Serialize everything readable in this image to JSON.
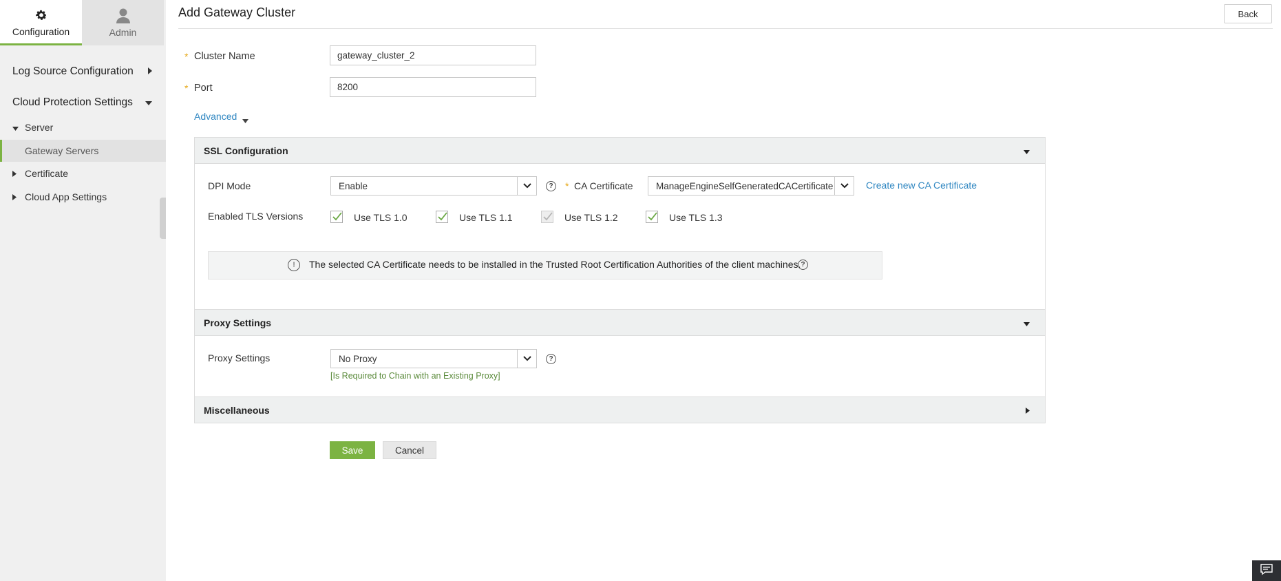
{
  "sidebar": {
    "tabs": [
      {
        "label": "Configuration",
        "icon": "gear-icon"
      },
      {
        "label": "Admin",
        "icon": "user-icon"
      }
    ],
    "sections": {
      "log_source": "Log Source Configuration",
      "cloud_protection": "Cloud Protection Settings"
    },
    "items": {
      "server": "Server",
      "gateway_servers": "Gateway Servers",
      "certificate": "Certificate",
      "cloud_app_settings": "Cloud App Settings"
    }
  },
  "header": {
    "title": "Add Gateway Cluster",
    "back_label": "Back"
  },
  "form": {
    "cluster_name_label": "Cluster Name",
    "cluster_name_value": "gateway_cluster_2",
    "port_label": "Port",
    "port_value": "8200",
    "advanced_label": "Advanced"
  },
  "ssl": {
    "title": "SSL Configuration",
    "dpi_mode_label": "DPI Mode",
    "dpi_mode_value": "Enable",
    "ca_cert_label": "CA Certificate",
    "ca_cert_value": "ManageEngineSelfGeneratedCACertificate",
    "create_ca_link": "Create new CA Certificate",
    "tls_label": "Enabled TLS Versions",
    "tls_options": [
      {
        "label": "Use TLS 1.0",
        "checked": true,
        "disabled": false
      },
      {
        "label": "Use TLS 1.1",
        "checked": true,
        "disabled": false
      },
      {
        "label": "Use TLS 1.2",
        "checked": true,
        "disabled": true
      },
      {
        "label": "Use TLS 1.3",
        "checked": true,
        "disabled": false
      }
    ],
    "info_text": "The selected CA Certificate needs to be installed in the Trusted Root Certification Authorities of the client machines."
  },
  "proxy": {
    "title": "Proxy Settings",
    "label": "Proxy Settings",
    "value": "No Proxy",
    "hint": "[Is Required to Chain with an Existing Proxy]"
  },
  "misc": {
    "title": "Miscellaneous"
  },
  "actions": {
    "save_label": "Save",
    "cancel_label": "Cancel"
  },
  "colors": {
    "accent": "#7cb342",
    "link": "#2e86c1",
    "required": "#e6a817"
  }
}
